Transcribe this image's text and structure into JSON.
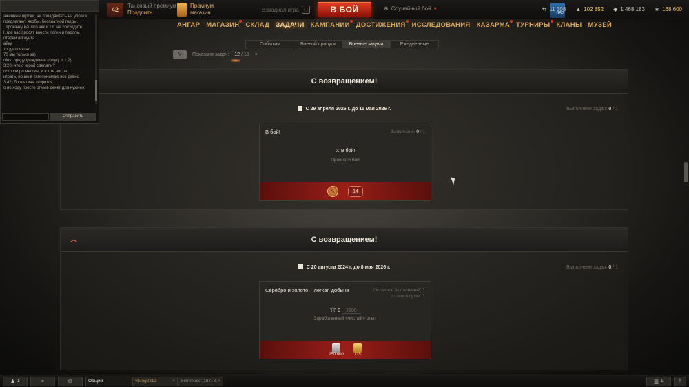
{
  "topbar": {
    "level": "42",
    "tank_premium_label": "Танковый премиум",
    "tank_premium_action": "Продлить",
    "premium_shop_line1": "Премиум",
    "premium_shop_line2": "магазин",
    "platoon_label": "Взводная игра",
    "battle_button": "В БОЙ",
    "battle_mode": "Случайный бой",
    "tank_count": "687",
    "currencies": {
      "free_xp": "11 308",
      "gold": "102 852",
      "credits": "1 468 183",
      "xp": "168 600"
    }
  },
  "nav": {
    "items": [
      {
        "label": "АНГАР"
      },
      {
        "label": "МАГАЗИН"
      },
      {
        "label": "СКЛАД"
      },
      {
        "label": "ЗАДАЧИ"
      },
      {
        "label": "КАМПАНИИ"
      },
      {
        "label": "ДОСТИЖЕНИЯ"
      },
      {
        "label": "ИССЛЕДОВАНИЯ"
      },
      {
        "label": "КАЗАРМА"
      },
      {
        "label": "ТУРНИРЫ"
      },
      {
        "label": "КЛАНЫ"
      },
      {
        "label": "МУЗЕЙ"
      }
    ],
    "active_index": 3
  },
  "subtabs": [
    {
      "label": "События"
    },
    {
      "label": "Боевой пропуск"
    },
    {
      "label": "Боевые задачи"
    },
    {
      "label": "Ежедневные"
    }
  ],
  "filter": {
    "label": "Показано задач:",
    "shown": "12",
    "total": "13",
    "clear": "×"
  },
  "chat": {
    "lines": [
      "аженные игроки, не попадайтесь на уловки",
      "предлагают, якобы, бесплатной голды,",
      ", прокачку вашего акк и т.д. не посходите",
      "l, где вас просят ввести логин и пароль.",
      "отерей аккаунта.",
      "айку",
      "тогда понятно",
      "70 мы только за)",
      "ofus, предупреждение (флуд, п.1.2)",
      "3:20) что с игрой сделали?",
      "осто скоро многие, и в том числе,",
      "играть, но им в там понимаю все равно",
      "3:42) бродятина творится",
      "о по ходу просто отмыв денег для нужных"
    ],
    "send_label": "Отправить"
  },
  "blocks": [
    {
      "title": "С возвращением!",
      "date": "С 29 апреля 2026 г. до 11 мая 2026 г.",
      "done_label": "Выполнено задач:",
      "done": "0",
      "done_total": "1",
      "card": {
        "title": "В бой!",
        "meta_label": "Выполнено:",
        "meta_value": "0",
        "meta_total": "1",
        "cond_name": "В бой!",
        "cond_desc": "Провести бой",
        "reward_icon": "booster",
        "reward_badge": "14"
      }
    },
    {
      "title": "С возвращением!",
      "date": "С 20 августа 2024 г. до 8 мая 2026 г.",
      "done_label": "Выполнено задач:",
      "done": "0",
      "done_total": "1",
      "card": {
        "title": "Серебро и золото – лёгкая добыча",
        "meta1_label": "Осталось выполнений:",
        "meta1_value": "1",
        "meta2_label": "Из них в сутки:",
        "meta2_value": "1",
        "progress_current": "0",
        "progress_target": "2500",
        "cond_desc": "Заработанный «чистый» опыт",
        "reward_credits": "250 000",
        "reward_gold": "125"
      }
    }
  ],
  "bottombar": {
    "online_count": "1",
    "channel_main": "Общий",
    "channel_2": "viking2312",
    "channel_3": "Sommuee: 187, В.",
    "notifications": "1"
  },
  "colors": {
    "accent": "#d9a65a",
    "battle_button": "#c8281a",
    "reward_band": "#9b1e18"
  }
}
